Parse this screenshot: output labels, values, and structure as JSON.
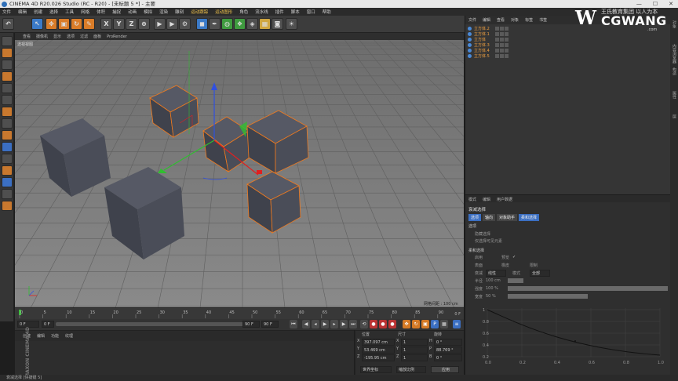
{
  "window": {
    "title": "CINEMA 4D R20.026 Studio (RC - R20) - [未标题 5 *] - 主要",
    "min_label": "—",
    "max_label": "☐",
    "close_label": "✕"
  },
  "menu": [
    "文件",
    "编辑",
    "创建",
    "选择",
    "工具",
    "网格",
    "体积",
    "捕捉",
    "动画",
    "模拟",
    "渲染",
    "雕刻",
    "运动跟踪",
    "运动图形",
    "角色",
    "流水线",
    "插件",
    "脚本",
    "窗口",
    "帮助"
  ],
  "menu_highlight_indices": [
    12,
    13
  ],
  "toolbar": {
    "axis_x": "X",
    "axis_y": "Y",
    "axis_z": "Z"
  },
  "viewport": {
    "menus": [
      "查看",
      "摄像机",
      "显示",
      "选项",
      "过滤",
      "面板",
      "ProRender"
    ],
    "label": "透视视图",
    "grid_spacing": "网格间距 : 100 cm",
    "colors": {
      "background": "#7a7a7a",
      "cube": "#474a55",
      "selection": "#f07a1e"
    }
  },
  "timeline": {
    "ticks": [
      "0",
      "5",
      "10",
      "15",
      "20",
      "25",
      "30",
      "35",
      "40",
      "45",
      "50",
      "55",
      "60",
      "65",
      "70",
      "75",
      "80",
      "85",
      "90"
    ],
    "frame_end_label": "0 F"
  },
  "transport": {
    "current_frame": "0 F",
    "start_frame": "0 F",
    "end_frame": "90 F",
    "end_frame_2": "90 F"
  },
  "material_panel": {
    "tabs": [
      "创建",
      "编辑",
      "功能",
      "纹理"
    ],
    "brand_vertical": "MAXON CINEMA 4D"
  },
  "coordinates": {
    "headers": [
      "位置",
      "尺寸",
      "旋转"
    ],
    "rows": [
      {
        "axis": "X",
        "pos": "397.097 cm",
        "size_axis": "X",
        "size": "1",
        "rot_axis": "H",
        "rot": "0 °"
      },
      {
        "axis": "Y",
        "pos": "53.469 cm",
        "size_axis": "Y",
        "size": "1",
        "rot_axis": "P",
        "rot": "88.769 °"
      },
      {
        "axis": "Z",
        "pos": "-195.95 cm",
        "size_axis": "Z",
        "size": "1",
        "rot_axis": "B",
        "rot": "0 °"
      }
    ],
    "mode_world": "世界坐标",
    "mode_scale": "缩放比例",
    "apply_label": "应用"
  },
  "objects_panel": {
    "tabs": [
      "文件",
      "编辑",
      "查看",
      "对象",
      "标签",
      "书签"
    ],
    "objects": [
      "立方体.2",
      "立方体.1",
      "立方体",
      "立方体.3",
      "立方体.4",
      "立方体.5"
    ]
  },
  "attributes_panel": {
    "menu": [
      "模式",
      "编辑",
      "用户数据"
    ],
    "title": "衰减选择",
    "tabs": [
      "选项",
      "轴向",
      "对象助手",
      "柔和选择"
    ],
    "section_options": "选项",
    "opt1": "隐藏选择",
    "opt2": "仅选择可见元素",
    "section_soft": "柔和选择",
    "rows": [
      {
        "label": "启用",
        "label2": "预览",
        "val2": "✓"
      },
      {
        "label": "表面",
        "label2": "橡皮",
        "label3": "限制"
      },
      {
        "label": "衰减",
        "value": "线性",
        "label2": "模式",
        "value2": "全部"
      }
    ],
    "radius_label": "半径",
    "radius_value": "100 cm",
    "strength_label": "强度",
    "strength_value": "100 %",
    "width_label": "宽度",
    "width_value": "50 %",
    "graph_y": [
      "1",
      "0.8",
      "0.6",
      "0.4",
      "0.2"
    ],
    "graph_x": [
      "0.0",
      "0.2",
      "0.4",
      "0.6",
      "0.8",
      "1.0"
    ]
  },
  "side_tabs": [
    "对象",
    "内容浏览器",
    "构造",
    "属性",
    "层"
  ],
  "status": "衰减选择 [快捷键 5]",
  "logo": {
    "mark": "W",
    "cn": "王氏教育集团 以人为本",
    "en": "CGWANG",
    "url": ".com"
  }
}
